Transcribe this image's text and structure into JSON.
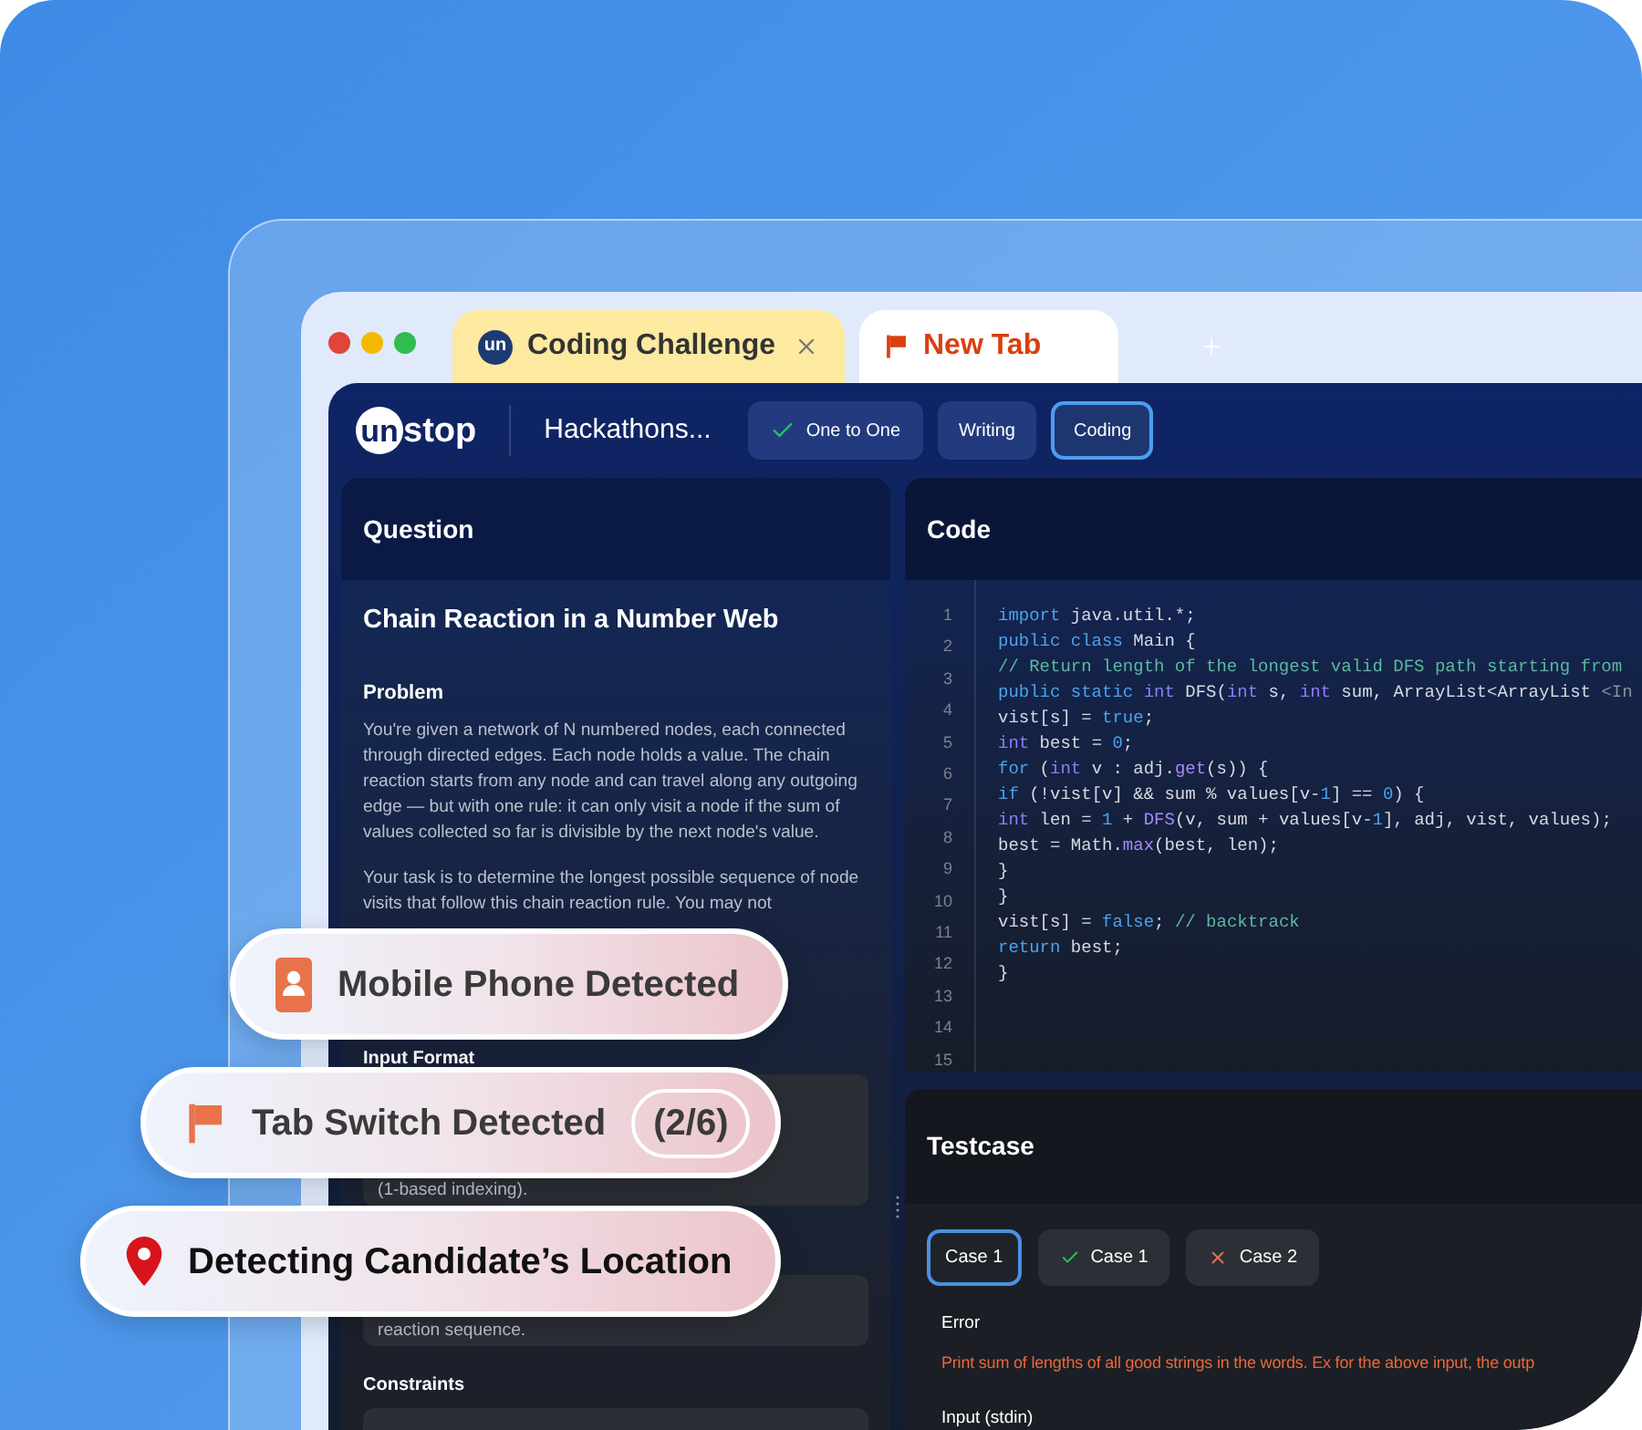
{
  "browser": {
    "tabs": [
      {
        "label": "Coding Challenge",
        "selected": true,
        "logo_text": "un"
      },
      {
        "label": "New Tab",
        "selected": false
      }
    ]
  },
  "app": {
    "logo": {
      "mark": "un",
      "text": "stop"
    },
    "title": "Hackathons...",
    "rounds": [
      {
        "label": "One to One",
        "done": true,
        "selected": false
      },
      {
        "label": "Writing",
        "done": false,
        "selected": false
      },
      {
        "label": "Coding",
        "done": false,
        "selected": true
      }
    ]
  },
  "question": {
    "header": "Question",
    "title": "Chain Reaction in a Number Web",
    "problem_label": "Problem",
    "paragraphs": [
      "You're given a network of N numbered nodes, each connected through directed edges. Each node holds a value. The chain reaction starts from any node and can travel along any outgoing edge — but with one rule: it can only visit a node if the sum of values collected so far is divisible by the next node's value.",
      "Your task is to determine the longest possible sequence of node visits that follow this chain reaction rule. You may not"
    ],
    "sections": [
      {
        "label": "Input Format",
        "lines": [
          "(1-based indexing)."
        ]
      },
      {
        "lines": [
          "reaction sequence."
        ]
      },
      {
        "label": "Constraints"
      }
    ]
  },
  "code": {
    "header": "Code",
    "line_numbers": [
      "1",
      "2",
      "3",
      "4",
      "5",
      "6",
      "7",
      "8",
      "9",
      "10",
      "11",
      "12",
      "13",
      "14",
      "15"
    ],
    "lines": [
      [
        {
          "kind": "keyword",
          "text": "import"
        },
        {
          "kind": "plain",
          "text": " java.util.*;"
        }
      ],
      [
        {
          "kind": "keyword",
          "text": "public class"
        },
        {
          "kind": "plain",
          "text": " Main {"
        }
      ],
      [
        {
          "kind": "comment",
          "text": "// Return length of the longest valid DFS path starting from"
        }
      ],
      [
        {
          "kind": "keyword",
          "text": "public static "
        },
        {
          "kind": "type",
          "text": "int"
        },
        {
          "kind": "plain",
          "text": " DFS("
        },
        {
          "kind": "type",
          "text": "int"
        },
        {
          "kind": "plain",
          "text": " s, "
        },
        {
          "kind": "type",
          "text": "int"
        },
        {
          "kind": "plain",
          "text": " sum, ArrayList<ArrayList "
        },
        {
          "kind": "dim",
          "text": "<In"
        }
      ],
      [
        {
          "kind": "plain",
          "text": "vist[s] = "
        },
        {
          "kind": "keyword",
          "text": "true"
        },
        {
          "kind": "plain",
          "text": ";"
        }
      ],
      [
        {
          "kind": "type",
          "text": "int"
        },
        {
          "kind": "plain",
          "text": " best = "
        },
        {
          "kind": "number",
          "text": "0"
        },
        {
          "kind": "plain",
          "text": ";"
        }
      ],
      [
        {
          "kind": "keyword",
          "text": "for"
        },
        {
          "kind": "plain",
          "text": " ("
        },
        {
          "kind": "type",
          "text": "int"
        },
        {
          "kind": "plain",
          "text": " v : adj."
        },
        {
          "kind": "function",
          "text": "get"
        },
        {
          "kind": "plain",
          "text": "(s)) {"
        }
      ],
      [
        {
          "kind": "keyword",
          "text": "if"
        },
        {
          "kind": "plain",
          "text": " (!vist[v] && sum % values[v-"
        },
        {
          "kind": "number",
          "text": "1"
        },
        {
          "kind": "plain",
          "text": "] == "
        },
        {
          "kind": "number",
          "text": "0"
        },
        {
          "kind": "plain",
          "text": ") {"
        }
      ],
      [
        {
          "kind": "type",
          "text": "int"
        },
        {
          "kind": "plain",
          "text": " len = "
        },
        {
          "kind": "number",
          "text": "1"
        },
        {
          "kind": "plain",
          "text": " + "
        },
        {
          "kind": "function",
          "text": "DFS"
        },
        {
          "kind": "plain",
          "text": "(v, sum + values[v-"
        },
        {
          "kind": "number",
          "text": "1"
        },
        {
          "kind": "plain",
          "text": "], adj, vist, values);"
        }
      ],
      [
        {
          "kind": "plain",
          "text": "best = Math."
        },
        {
          "kind": "function",
          "text": "max"
        },
        {
          "kind": "plain",
          "text": "(best, len);"
        }
      ],
      [
        {
          "kind": "plain",
          "text": "}"
        }
      ],
      [
        {
          "kind": "plain",
          "text": "}"
        }
      ],
      [
        {
          "kind": "plain",
          "text": "vist[s] = "
        },
        {
          "kind": "keyword",
          "text": "false"
        },
        {
          "kind": "plain",
          "text": "; "
        },
        {
          "kind": "comment",
          "text": "// backtrack"
        }
      ],
      [
        {
          "kind": "keyword",
          "text": "return"
        },
        {
          "kind": "plain",
          "text": " best;"
        }
      ],
      [
        {
          "kind": "plain",
          "text": "}"
        }
      ]
    ]
  },
  "testcase": {
    "header": "Testcase",
    "cases": [
      {
        "label": "Case 1",
        "selected": true,
        "kind": "plain"
      },
      {
        "label": "Case 1",
        "selected": false,
        "kind": "pass"
      },
      {
        "label": "Case 2",
        "selected": false,
        "kind": "fail"
      }
    ],
    "error_label": "Error",
    "error_text": "Print sum of lengths of all good strings in the words. Ex for the above input, the outp",
    "input_label": "Input (stdin)"
  },
  "alerts": [
    {
      "kind": "phone",
      "text": "Mobile Phone Detected"
    },
    {
      "kind": "flag",
      "text": "Tab Switch Detected",
      "count": "(2/6)"
    },
    {
      "kind": "location",
      "text": "Detecting Candidate’s Location"
    }
  ]
}
